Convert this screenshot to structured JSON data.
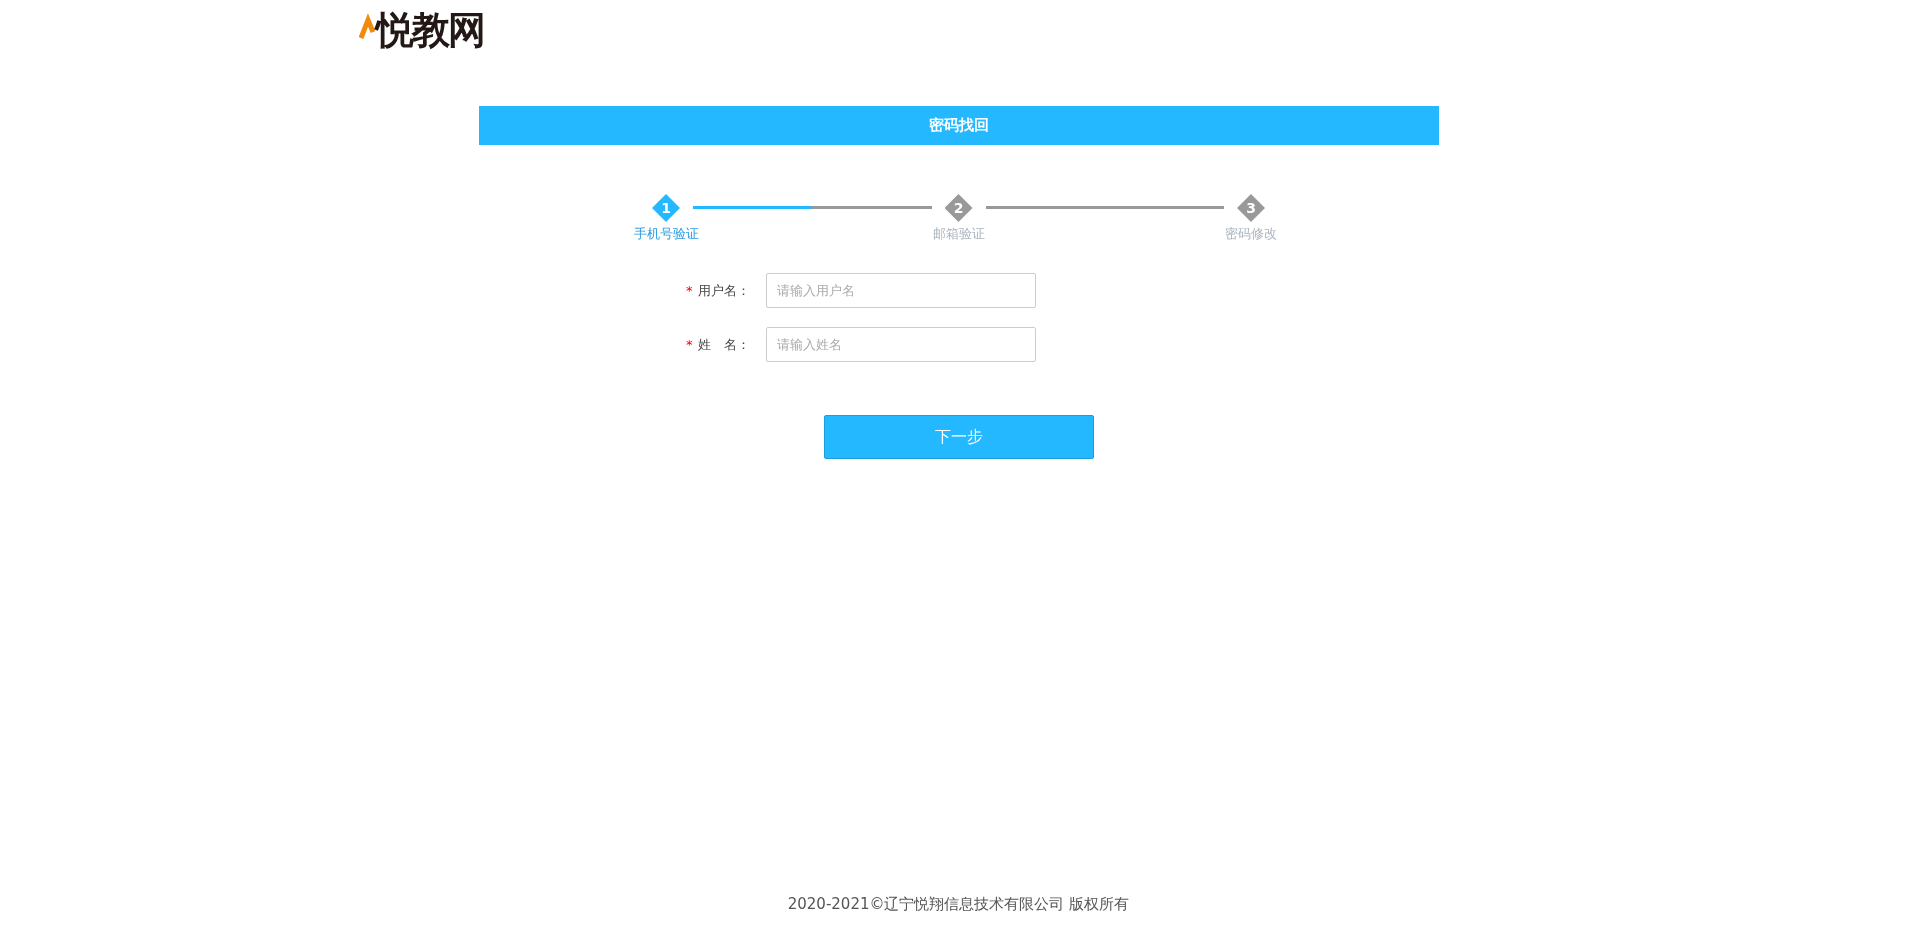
{
  "logo": {
    "text": "悦教网"
  },
  "header": {
    "title": "密码找回"
  },
  "steps": [
    {
      "number": "1",
      "label": "手机号验证",
      "selected": true
    },
    {
      "number": "2",
      "label": "邮箱验证",
      "selected": false
    },
    {
      "number": "3",
      "label": "密码修改",
      "selected": false
    }
  ],
  "connectors": [
    {
      "level": 0.5
    },
    {
      "level": 0
    }
  ],
  "form": {
    "fields": [
      {
        "mark": "*",
        "label": "用户名：",
        "placeholder": "请输入用户名"
      },
      {
        "mark": "*",
        "label": "姓　名：",
        "placeholder": "请输入姓名"
      }
    ],
    "submit": "下一步"
  },
  "footer": {
    "text": "2020-2021©辽宁悦翔信息技术有限公司 版权所有"
  }
}
